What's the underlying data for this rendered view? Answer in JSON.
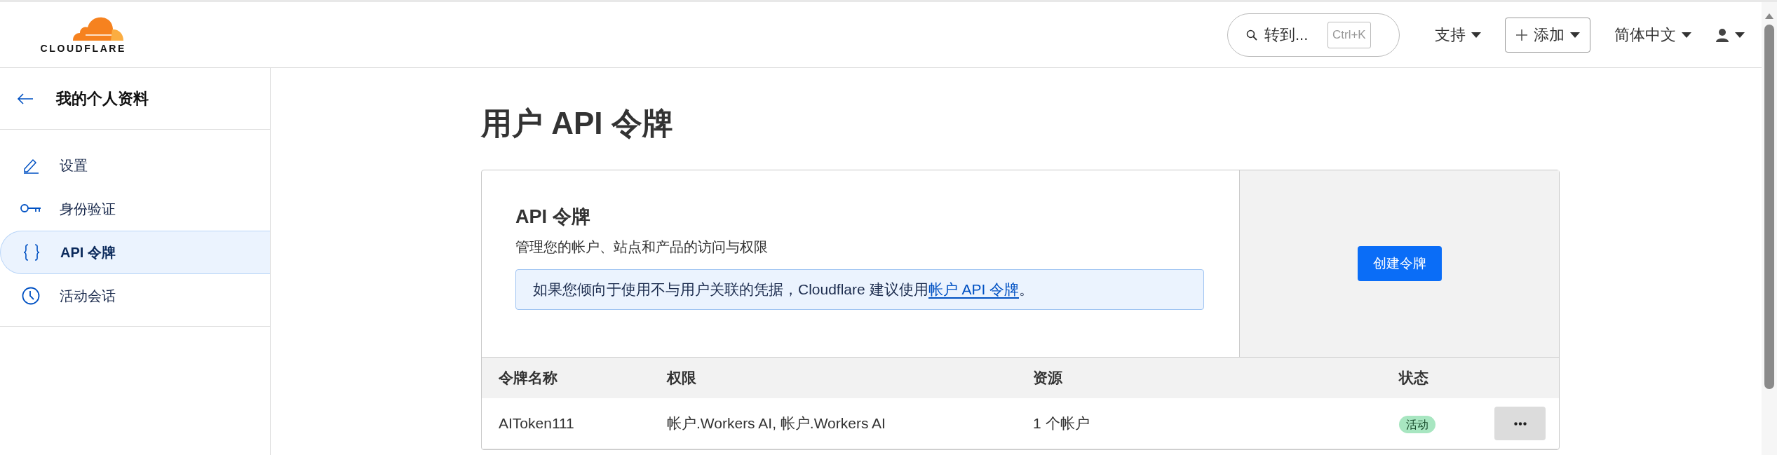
{
  "header": {
    "logo": "CLOUDFLARE",
    "search": {
      "placeholder": "转到...",
      "shortcut": "Ctrl+K"
    },
    "menu": [
      {
        "label": "支持",
        "kind": "menu"
      },
      {
        "label": "添加",
        "kind": "add"
      },
      {
        "label": "简体中文",
        "kind": "menu"
      },
      {
        "kind": "user"
      }
    ]
  },
  "sidebar": {
    "title": "我的个人资料",
    "items": [
      {
        "label": "设置",
        "kind": "pencil",
        "selected": false
      },
      {
        "label": "身份验证",
        "kind": "key",
        "selected": false
      },
      {
        "label": "API 令牌",
        "kind": "braces",
        "selected": true
      },
      {
        "label": "活动会话",
        "kind": "clock",
        "selected": false
      }
    ]
  },
  "page": {
    "title": "用户 API 令牌",
    "card": {
      "heading": "API 令牌",
      "description": "管理您的帐户、站点和产品的访问与权限",
      "notice": {
        "text": "如果您倾向于使用不与用户关联的凭据，Cloudflare 建议使用",
        "link": "帐户 API 令牌",
        "end": "。"
      },
      "button": "创建令牌"
    },
    "table": {
      "columns": [
        "令牌名称",
        "权限",
        "资源",
        "状态"
      ],
      "rows": [
        {
          "name": "AIToken111",
          "permissions": "帐户.Workers AI, 帐户.Workers AI",
          "resources": "1 个帐户",
          "status": "活动"
        }
      ]
    }
  }
}
